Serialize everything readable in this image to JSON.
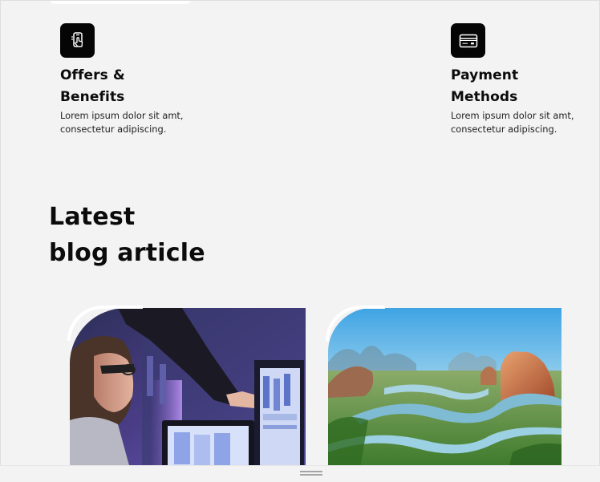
{
  "features": [
    {
      "title": "Offers & Benefits",
      "description": "Lorem ipsum dolor sit amt, consectetur adipiscing.",
      "icon": "phone-tap-icon"
    },
    {
      "title": "Payment Methods",
      "description": "Lorem ipsum dolor sit amt, consectetur adipiscing.",
      "icon": "credit-card-icon"
    }
  ],
  "blog": {
    "heading_line1": "Latest",
    "heading_line2": "blog article"
  },
  "colors": {
    "background": "#f4f3f3",
    "icon_tile": "#050505",
    "text": "#0b0b0b"
  }
}
